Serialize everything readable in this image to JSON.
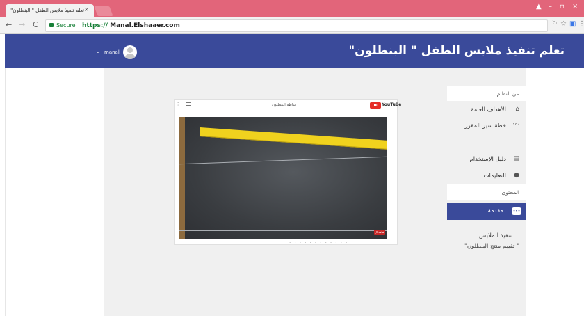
{
  "browser": {
    "tab_title": "تعلم تنفيذ ملابس الطفل \" البنطلون\"",
    "tab_close": "×",
    "window_controls": {
      "user": "▲",
      "minimize": "–",
      "maximize": "▫",
      "close": "×"
    },
    "nav": {
      "back": "←",
      "forward": "→",
      "reload": "C"
    },
    "secure_label": "Secure",
    "url_scheme": "https://",
    "url_host": " Manal.Elshaaer.com",
    "toolbar_icons": {
      "translate": "⚐",
      "bookmark": "☆",
      "extension": "▣",
      "menu": "⋮"
    }
  },
  "header": {
    "title": "تعلم تنفيذ ملابس الطفل \" البنطلون\"",
    "user_name": "manal",
    "caret": "⌄"
  },
  "sidebar": {
    "about_header": "عن النظام",
    "items": [
      {
        "label": "الأهداف العامة",
        "icon": "tag-icon",
        "glyph": "⌂"
      },
      {
        "label": "خطة سير المقرر",
        "icon": "trend-icon",
        "glyph": "〰"
      },
      {
        "label": "دليل الإستخدام",
        "icon": "document-icon",
        "glyph": "▤"
      },
      {
        "label": "التعليمات",
        "icon": "info-icon",
        "glyph": "●"
      }
    ],
    "content_header": "المحتوى",
    "active_item": {
      "label": "مقدمة",
      "icon": "chat-icon",
      "glyph": "•••"
    },
    "note_line1": "تنفيذ الملابس",
    "note_line2": "\" تقييم منتج البنطلون\""
  },
  "video": {
    "title": "مباطة البنطلون",
    "brand": "YouTube",
    "more": "⋮",
    "badge": "شاهد ال"
  },
  "colors": {
    "tabstrip": "#e2657a",
    "header": "#3a4a9a",
    "secure": "#188038",
    "ruler": "#f0d21e"
  }
}
